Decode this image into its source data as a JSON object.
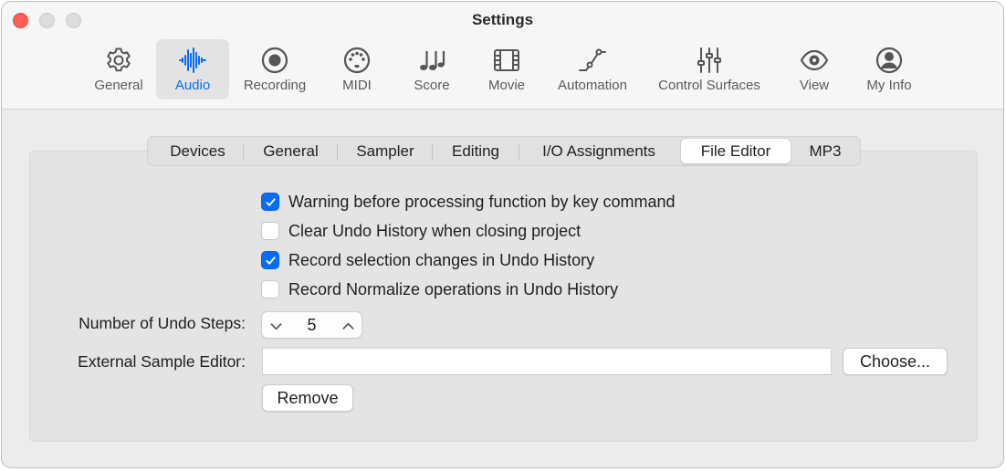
{
  "window": {
    "title": "Settings"
  },
  "toolbar": {
    "items": [
      {
        "label": "General",
        "icon": "gear-icon"
      },
      {
        "label": "Audio",
        "icon": "waveform-icon",
        "selected": true
      },
      {
        "label": "Recording",
        "icon": "record-icon"
      },
      {
        "label": "MIDI",
        "icon": "midi-port-icon"
      },
      {
        "label": "Score",
        "icon": "music-notes-icon"
      },
      {
        "label": "Movie",
        "icon": "film-strip-icon"
      },
      {
        "label": "Automation",
        "icon": "automation-curve-icon"
      },
      {
        "label": "Control Surfaces",
        "icon": "sliders-icon"
      },
      {
        "label": "View",
        "icon": "eye-icon"
      },
      {
        "label": "My Info",
        "icon": "person-icon"
      }
    ],
    "accent_color": "#0a6cf5"
  },
  "tabs": {
    "items": [
      "Devices",
      "General",
      "Sampler",
      "Editing",
      "I/O Assignments",
      "File Editor",
      "MP3"
    ],
    "selected": "File Editor"
  },
  "options": [
    {
      "label": "Warning before processing function by key command",
      "checked": true
    },
    {
      "label": "Clear Undo History when closing project",
      "checked": false
    },
    {
      "label": "Record selection changes in Undo History",
      "checked": true
    },
    {
      "label": "Record Normalize operations in Undo History",
      "checked": false
    }
  ],
  "undo_steps": {
    "label": "Number of Undo Steps:",
    "value": "5"
  },
  "external_editor": {
    "label": "External Sample Editor:",
    "value": "",
    "choose_label": "Choose...",
    "remove_label": "Remove"
  }
}
